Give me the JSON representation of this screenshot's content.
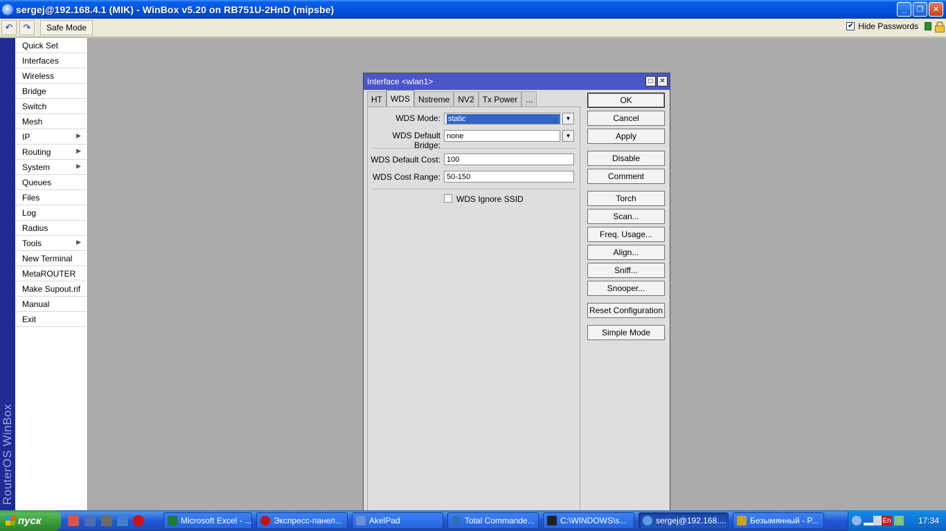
{
  "window": {
    "title": "sergej@192.168.4.1 (MIK) - WinBox v5.20 on RB751U-2HnD (mipsbe)"
  },
  "toolbar": {
    "undo_icon": "undo-icon",
    "redo_icon": "redo-icon",
    "safe_mode_label": "Safe Mode",
    "hide_passwords_label": "Hide Passwords",
    "hide_passwords_checked": "✔"
  },
  "vertical_brand": "RouterOS WinBox",
  "sidebar": {
    "items": [
      {
        "label": "Quick Set"
      },
      {
        "label": "Interfaces"
      },
      {
        "label": "Wireless"
      },
      {
        "label": "Bridge"
      },
      {
        "label": "Switch"
      },
      {
        "label": "Mesh"
      },
      {
        "label": "IP"
      },
      {
        "label": "Routing"
      },
      {
        "label": "System"
      },
      {
        "label": "Queues"
      },
      {
        "label": "Files"
      },
      {
        "label": "Log"
      },
      {
        "label": "Radius"
      },
      {
        "label": "Tools"
      },
      {
        "label": "New Terminal"
      },
      {
        "label": "MetaROUTER"
      },
      {
        "label": "Make Supout.rif"
      },
      {
        "label": "Manual"
      },
      {
        "label": "Exit"
      }
    ]
  },
  "dialog": {
    "title": "Interface <wlan1>",
    "tabs": [
      "HT",
      "WDS",
      "Nstreme",
      "NV2",
      "Tx Power",
      "..."
    ],
    "active_tab": "WDS",
    "fields": {
      "wds_mode_label": "WDS Mode:",
      "wds_mode_value": "static",
      "wds_default_bridge_label": "WDS Default Bridge:",
      "wds_default_bridge_value": "none",
      "wds_default_cost_label": "WDS Default Cost:",
      "wds_default_cost_value": "100",
      "wds_cost_range_label": "WDS Cost Range:",
      "wds_cost_range_value": "50-150",
      "wds_ignore_ssid_label": "WDS Ignore SSID"
    },
    "buttons": {
      "ok": "OK",
      "cancel": "Cancel",
      "apply": "Apply",
      "disable": "Disable",
      "comment": "Comment",
      "torch": "Torch",
      "scan": "Scan...",
      "freq_usage": "Freq. Usage...",
      "align": "Align...",
      "sniff": "Sniff...",
      "snooper": "Snooper...",
      "reset_configuration": "Reset Configuration",
      "simple_mode": "Simple Mode"
    }
  },
  "taskbar": {
    "start_label": "пуск",
    "tasks": [
      {
        "label": "Microsoft Excel - ...",
        "color": "#1e7b34"
      },
      {
        "label": "Экспресс-панел...",
        "color": "#cc1010"
      },
      {
        "label": "AkelPad",
        "color": "#6a8fd4"
      },
      {
        "label": "Total Commande...",
        "color": "#2c6fb8"
      },
      {
        "label": "C:\\WINDOWS\\s...",
        "color": "#222222"
      },
      {
        "label": "sergej@192.168....",
        "color": "#5c9be6"
      },
      {
        "label": "Безымянный - P...",
        "color": "#c9a227"
      }
    ],
    "tray_lang": "En",
    "clock": "17:34"
  }
}
